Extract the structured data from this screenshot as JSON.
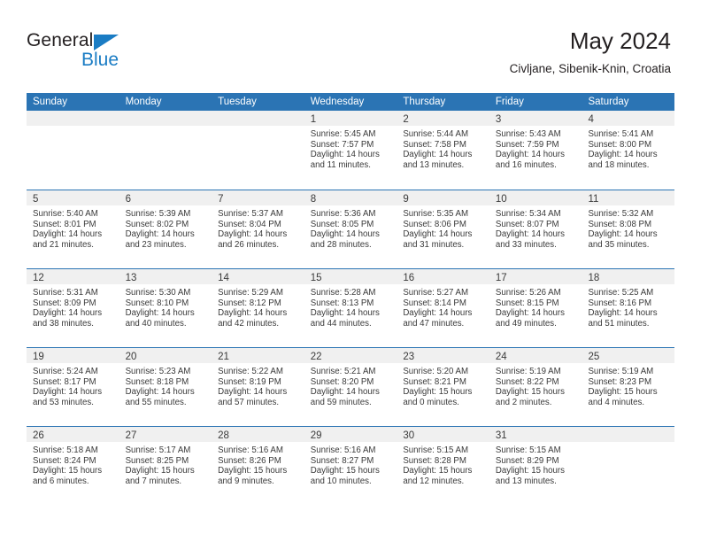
{
  "brand": {
    "name_part1": "General",
    "name_part2": "Blue",
    "triangle_icon": "blue-triangle-icon",
    "color_dark": "#231f20",
    "color_blue": "#1a7cc4"
  },
  "header": {
    "title": "May 2024",
    "subtitle": "Civljane, Sibenik-Knin, Croatia",
    "accent_color": "#2b74b4",
    "band_color": "#f0f0f0"
  },
  "calendar": {
    "day_names": [
      "Sunday",
      "Monday",
      "Tuesday",
      "Wednesday",
      "Thursday",
      "Friday",
      "Saturday"
    ],
    "labels": {
      "sunrise": "Sunrise:",
      "sunset": "Sunset:",
      "daylight": "Daylight:"
    },
    "weeks": [
      [
        {
          "day": "",
          "empty": true
        },
        {
          "day": "",
          "empty": true
        },
        {
          "day": "",
          "empty": true
        },
        {
          "day": "1",
          "sunrise": "Sunrise: 5:45 AM",
          "sunset": "Sunset: 7:57 PM",
          "daylight1": "Daylight: 14 hours",
          "daylight2": "and 11 minutes."
        },
        {
          "day": "2",
          "sunrise": "Sunrise: 5:44 AM",
          "sunset": "Sunset: 7:58 PM",
          "daylight1": "Daylight: 14 hours",
          "daylight2": "and 13 minutes."
        },
        {
          "day": "3",
          "sunrise": "Sunrise: 5:43 AM",
          "sunset": "Sunset: 7:59 PM",
          "daylight1": "Daylight: 14 hours",
          "daylight2": "and 16 minutes."
        },
        {
          "day": "4",
          "sunrise": "Sunrise: 5:41 AM",
          "sunset": "Sunset: 8:00 PM",
          "daylight1": "Daylight: 14 hours",
          "daylight2": "and 18 minutes."
        }
      ],
      [
        {
          "day": "5",
          "sunrise": "Sunrise: 5:40 AM",
          "sunset": "Sunset: 8:01 PM",
          "daylight1": "Daylight: 14 hours",
          "daylight2": "and 21 minutes."
        },
        {
          "day": "6",
          "sunrise": "Sunrise: 5:39 AM",
          "sunset": "Sunset: 8:02 PM",
          "daylight1": "Daylight: 14 hours",
          "daylight2": "and 23 minutes."
        },
        {
          "day": "7",
          "sunrise": "Sunrise: 5:37 AM",
          "sunset": "Sunset: 8:04 PM",
          "daylight1": "Daylight: 14 hours",
          "daylight2": "and 26 minutes."
        },
        {
          "day": "8",
          "sunrise": "Sunrise: 5:36 AM",
          "sunset": "Sunset: 8:05 PM",
          "daylight1": "Daylight: 14 hours",
          "daylight2": "and 28 minutes."
        },
        {
          "day": "9",
          "sunrise": "Sunrise: 5:35 AM",
          "sunset": "Sunset: 8:06 PM",
          "daylight1": "Daylight: 14 hours",
          "daylight2": "and 31 minutes."
        },
        {
          "day": "10",
          "sunrise": "Sunrise: 5:34 AM",
          "sunset": "Sunset: 8:07 PM",
          "daylight1": "Daylight: 14 hours",
          "daylight2": "and 33 minutes."
        },
        {
          "day": "11",
          "sunrise": "Sunrise: 5:32 AM",
          "sunset": "Sunset: 8:08 PM",
          "daylight1": "Daylight: 14 hours",
          "daylight2": "and 35 minutes."
        }
      ],
      [
        {
          "day": "12",
          "sunrise": "Sunrise: 5:31 AM",
          "sunset": "Sunset: 8:09 PM",
          "daylight1": "Daylight: 14 hours",
          "daylight2": "and 38 minutes."
        },
        {
          "day": "13",
          "sunrise": "Sunrise: 5:30 AM",
          "sunset": "Sunset: 8:10 PM",
          "daylight1": "Daylight: 14 hours",
          "daylight2": "and 40 minutes."
        },
        {
          "day": "14",
          "sunrise": "Sunrise: 5:29 AM",
          "sunset": "Sunset: 8:12 PM",
          "daylight1": "Daylight: 14 hours",
          "daylight2": "and 42 minutes."
        },
        {
          "day": "15",
          "sunrise": "Sunrise: 5:28 AM",
          "sunset": "Sunset: 8:13 PM",
          "daylight1": "Daylight: 14 hours",
          "daylight2": "and 44 minutes."
        },
        {
          "day": "16",
          "sunrise": "Sunrise: 5:27 AM",
          "sunset": "Sunset: 8:14 PM",
          "daylight1": "Daylight: 14 hours",
          "daylight2": "and 47 minutes."
        },
        {
          "day": "17",
          "sunrise": "Sunrise: 5:26 AM",
          "sunset": "Sunset: 8:15 PM",
          "daylight1": "Daylight: 14 hours",
          "daylight2": "and 49 minutes."
        },
        {
          "day": "18",
          "sunrise": "Sunrise: 5:25 AM",
          "sunset": "Sunset: 8:16 PM",
          "daylight1": "Daylight: 14 hours",
          "daylight2": "and 51 minutes."
        }
      ],
      [
        {
          "day": "19",
          "sunrise": "Sunrise: 5:24 AM",
          "sunset": "Sunset: 8:17 PM",
          "daylight1": "Daylight: 14 hours",
          "daylight2": "and 53 minutes."
        },
        {
          "day": "20",
          "sunrise": "Sunrise: 5:23 AM",
          "sunset": "Sunset: 8:18 PM",
          "daylight1": "Daylight: 14 hours",
          "daylight2": "and 55 minutes."
        },
        {
          "day": "21",
          "sunrise": "Sunrise: 5:22 AM",
          "sunset": "Sunset: 8:19 PM",
          "daylight1": "Daylight: 14 hours",
          "daylight2": "and 57 minutes."
        },
        {
          "day": "22",
          "sunrise": "Sunrise: 5:21 AM",
          "sunset": "Sunset: 8:20 PM",
          "daylight1": "Daylight: 14 hours",
          "daylight2": "and 59 minutes."
        },
        {
          "day": "23",
          "sunrise": "Sunrise: 5:20 AM",
          "sunset": "Sunset: 8:21 PM",
          "daylight1": "Daylight: 15 hours",
          "daylight2": "and 0 minutes."
        },
        {
          "day": "24",
          "sunrise": "Sunrise: 5:19 AM",
          "sunset": "Sunset: 8:22 PM",
          "daylight1": "Daylight: 15 hours",
          "daylight2": "and 2 minutes."
        },
        {
          "day": "25",
          "sunrise": "Sunrise: 5:19 AM",
          "sunset": "Sunset: 8:23 PM",
          "daylight1": "Daylight: 15 hours",
          "daylight2": "and 4 minutes."
        }
      ],
      [
        {
          "day": "26",
          "sunrise": "Sunrise: 5:18 AM",
          "sunset": "Sunset: 8:24 PM",
          "daylight1": "Daylight: 15 hours",
          "daylight2": "and 6 minutes."
        },
        {
          "day": "27",
          "sunrise": "Sunrise: 5:17 AM",
          "sunset": "Sunset: 8:25 PM",
          "daylight1": "Daylight: 15 hours",
          "daylight2": "and 7 minutes."
        },
        {
          "day": "28",
          "sunrise": "Sunrise: 5:16 AM",
          "sunset": "Sunset: 8:26 PM",
          "daylight1": "Daylight: 15 hours",
          "daylight2": "and 9 minutes."
        },
        {
          "day": "29",
          "sunrise": "Sunrise: 5:16 AM",
          "sunset": "Sunset: 8:27 PM",
          "daylight1": "Daylight: 15 hours",
          "daylight2": "and 10 minutes."
        },
        {
          "day": "30",
          "sunrise": "Sunrise: 5:15 AM",
          "sunset": "Sunset: 8:28 PM",
          "daylight1": "Daylight: 15 hours",
          "daylight2": "and 12 minutes."
        },
        {
          "day": "31",
          "sunrise": "Sunrise: 5:15 AM",
          "sunset": "Sunset: 8:29 PM",
          "daylight1": "Daylight: 15 hours",
          "daylight2": "and 13 minutes."
        },
        {
          "day": "",
          "empty": true
        }
      ]
    ]
  }
}
